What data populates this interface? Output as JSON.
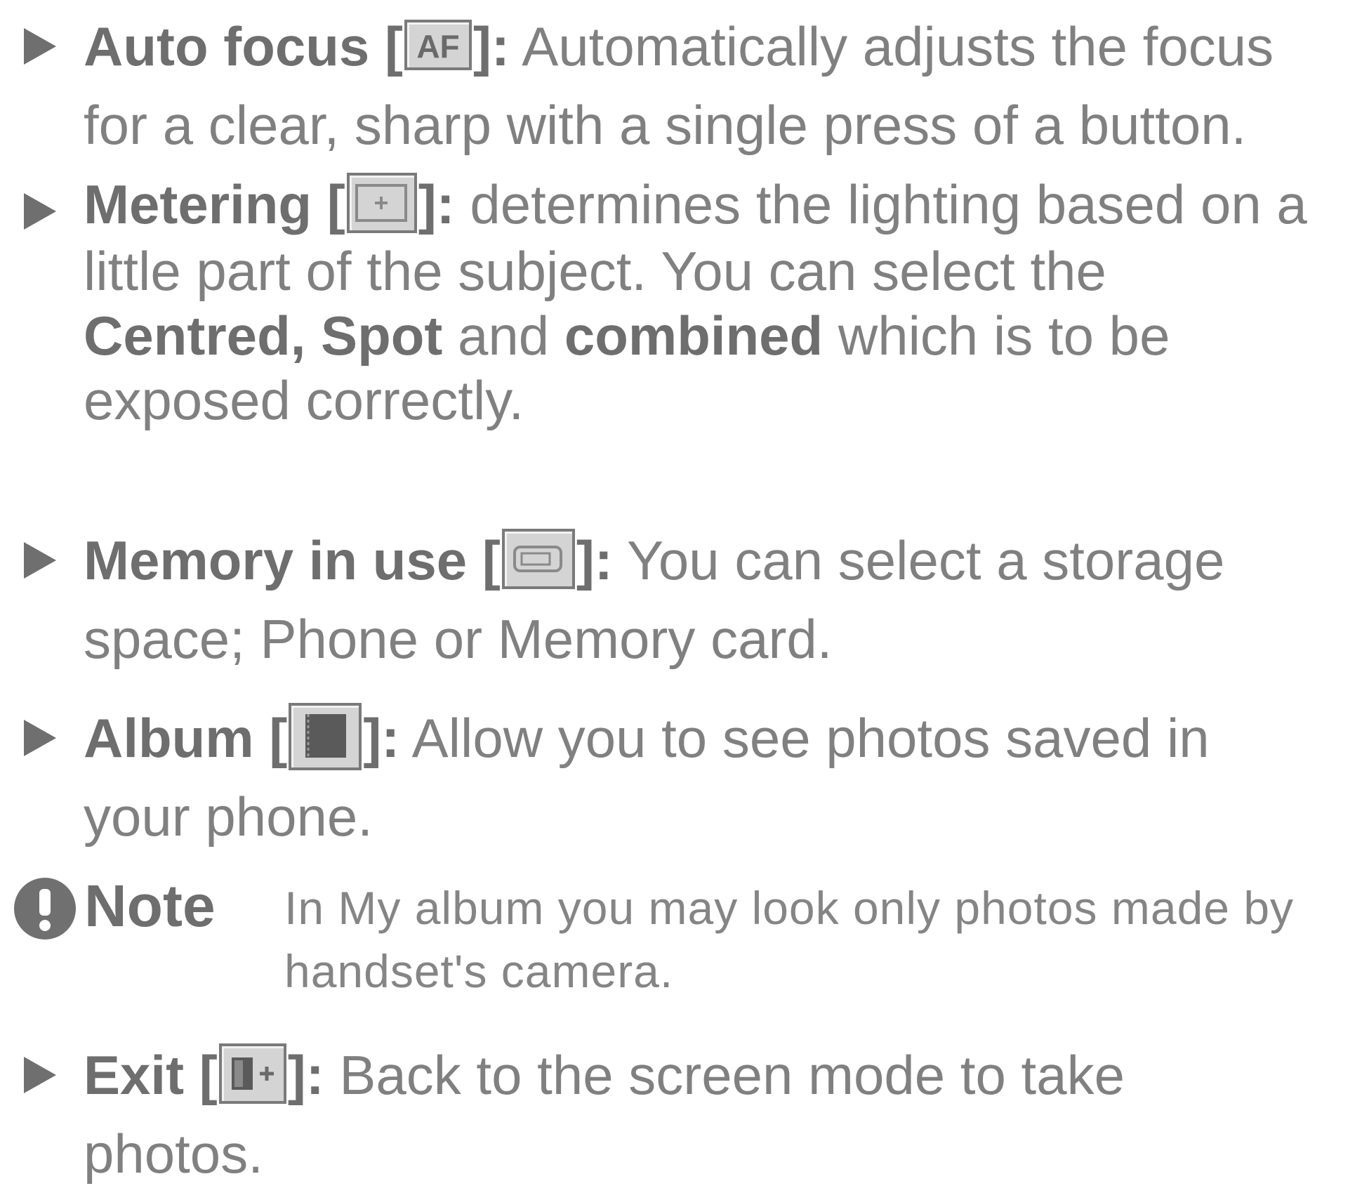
{
  "items": [
    {
      "name": "Auto focus",
      "icon": "af-icon",
      "icon_text": "AF",
      "lines": [
        "Automatically adjusts the focus",
        "for a clear, sharp with a single press of a button."
      ]
    },
    {
      "name": "Metering",
      "icon": "metering-icon",
      "line1": "determines the lighting based on a",
      "line2": "little part of the subject. You can select the",
      "opt1": "Centred, Spot",
      "and_text": "and",
      "opt2": "combined",
      "line3_tail": "which is to be",
      "line4": "exposed correctly."
    },
    {
      "name": "Memory in use",
      "icon": "memory-card-icon",
      "lines": [
        "You can select a storage",
        "space; Phone or Memory card."
      ]
    },
    {
      "name": "Album",
      "icon": "album-icon",
      "lines": [
        "Allow you to see photos saved in",
        "your phone."
      ]
    },
    {
      "name": "Exit",
      "icon": "exit-icon",
      "lines": [
        "Back to the screen mode to take",
        "photos."
      ]
    }
  ],
  "note": {
    "title": "Note",
    "lines": [
      "In My album you may look only photos made by",
      "handset's camera."
    ]
  },
  "colors": {
    "text": "#808080",
    "bold": "#6e6e6e",
    "icon_bg": "#d4d4d4",
    "icon_border": "#7a7a7a"
  }
}
